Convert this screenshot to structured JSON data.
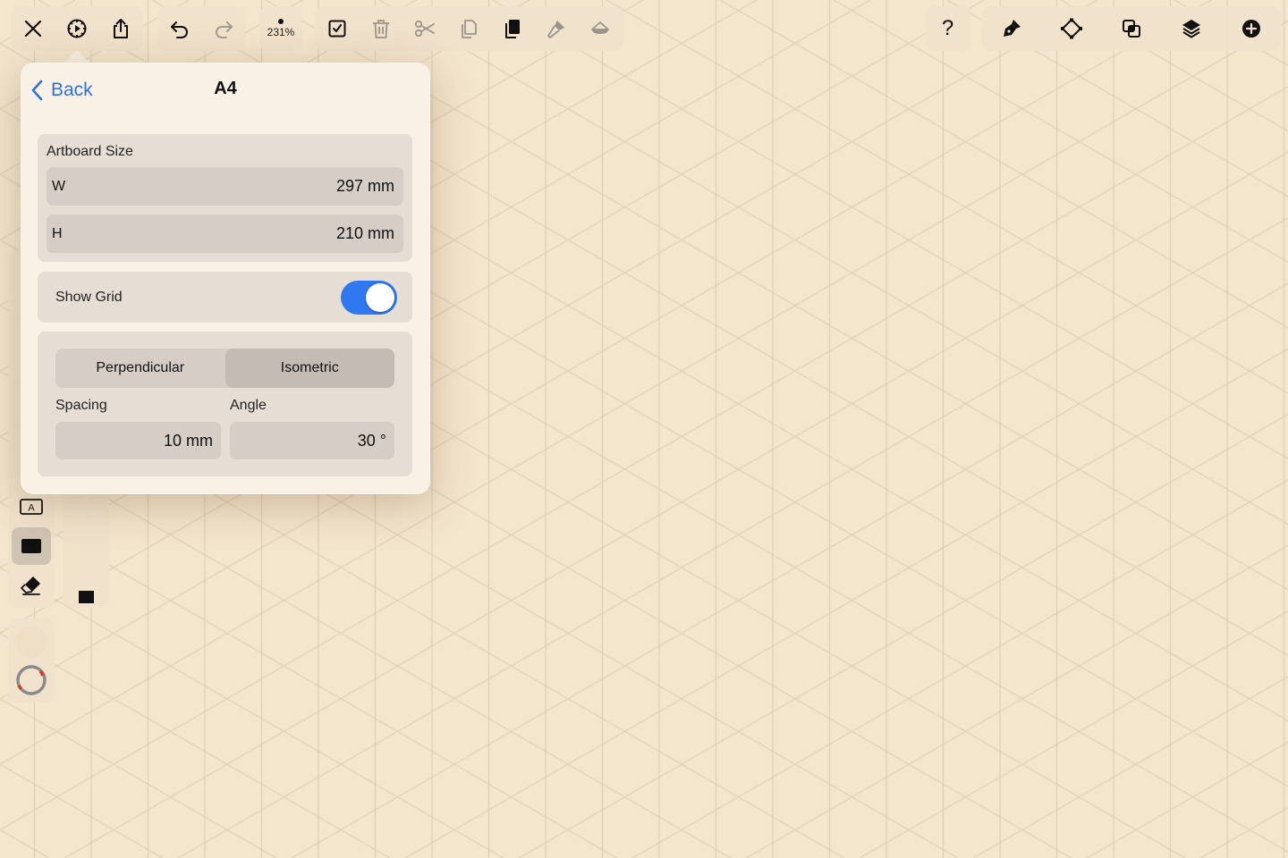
{
  "toolbar": {
    "zoom_label": "231%",
    "icons": [
      "close-icon",
      "settings-icon",
      "share-icon",
      "undo-icon",
      "redo-icon",
      "select-icon",
      "trash-icon",
      "scissors-icon",
      "copy-icon",
      "paste-icon",
      "style-copy-icon",
      "style-paste-icon",
      "help-icon",
      "pen-tool-icon",
      "node-tool-icon",
      "boolean-icon",
      "layers-icon",
      "add-icon"
    ],
    "help_label": "?"
  },
  "popover": {
    "back_label": "Back",
    "title": "A4",
    "artboard_label": "Artboard Size",
    "width_label": "W",
    "width_value": "297 mm",
    "height_label": "H",
    "height_value": "210 mm",
    "show_grid_label": "Show Grid",
    "show_grid_on": true,
    "grid_types": [
      "Perpendicular",
      "Isometric"
    ],
    "grid_type_selected": "Isometric",
    "spacing_label": "Spacing",
    "spacing_value": "10 mm",
    "angle_label": "Angle",
    "angle_value": "30 °"
  },
  "sidebar": {
    "tools": [
      "text-tool-icon",
      "shape-tool-icon",
      "eraser-icon"
    ],
    "active_tool": "shape-tool-icon",
    "text_tool_glyph": "A"
  },
  "colors": {
    "canvas_bg": "#f4e5cd",
    "grid_line": "#d9cab2",
    "accent": "#2f78ef",
    "link": "#2f6fe0"
  }
}
